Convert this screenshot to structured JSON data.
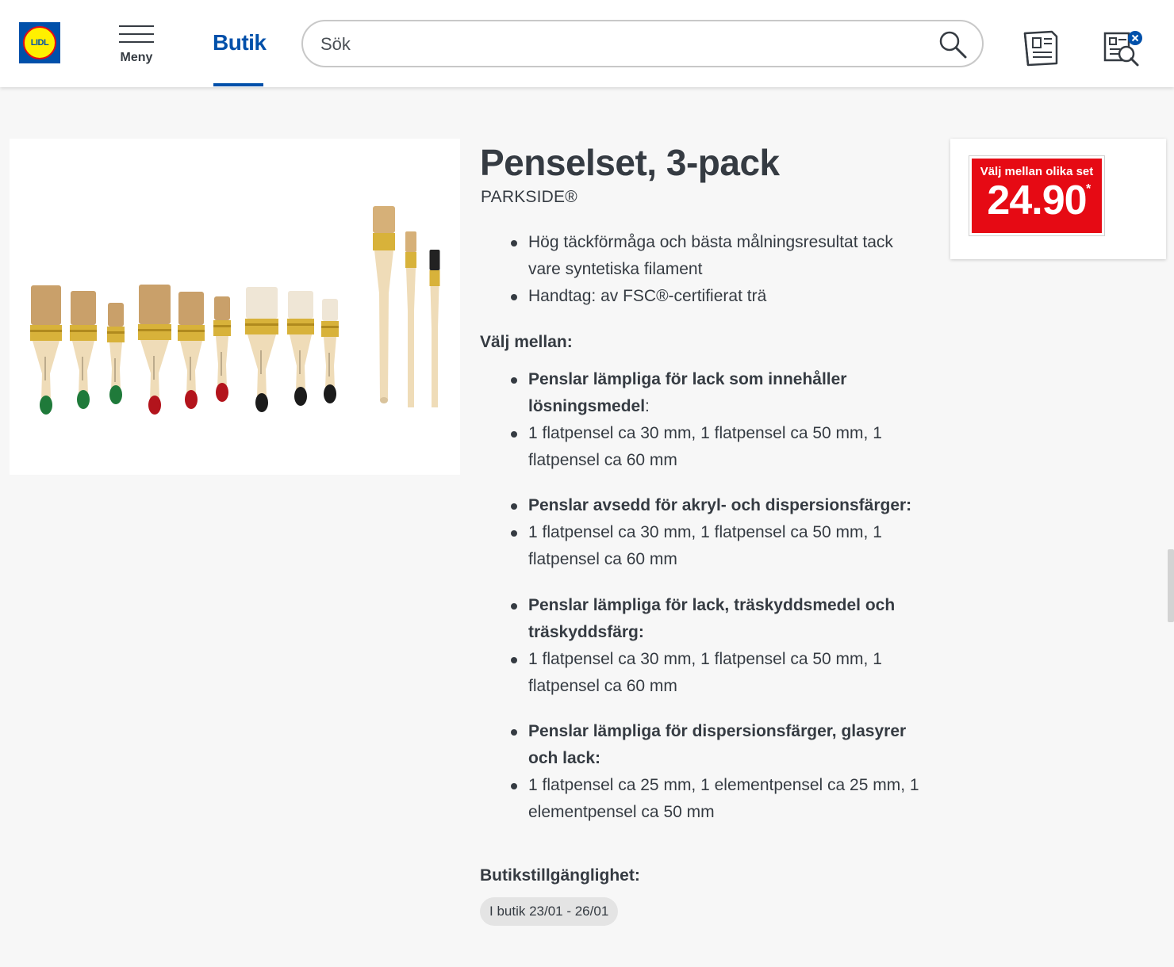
{
  "header": {
    "logo_text": "LIDL",
    "menu_label": "Meny",
    "nav_butik": "Butik",
    "search_placeholder": "Sök",
    "icons": [
      "search-icon",
      "flyer-icon",
      "shopping-list-icon"
    ]
  },
  "product": {
    "title": "Penselset, 3-pack",
    "brand": "PARKSIDE®",
    "features": [
      "Hög täckförmåga och bästa målningsresultat tack vare syntetiska filament",
      "Handtag: av FSC®-certifierat trä"
    ],
    "choose_heading": "Välj mellan:",
    "variants": [
      {
        "name": "Penslar lämpliga för lack som innehåller lösningsmedel",
        "suffix": ":",
        "content": "1 flatpensel ca 30 mm, 1 flatpensel ca 50 mm, 1 flatpensel ca 60 mm"
      },
      {
        "name": "Penslar avsedd för akryl- och dispersionsfärger:",
        "suffix": "",
        "content": "1 flatpensel ca 30 mm, 1 flatpensel ca 50 mm, 1 flatpensel ca 60 mm"
      },
      {
        "name": "Penslar lämpliga för lack, träskyddsmedel och träskyddsfärg:",
        "suffix": "",
        "content": "1 flatpensel ca 30 mm, 1 flatpensel ca 50 mm, 1 flatpensel ca 60 mm"
      },
      {
        "name": "Penslar lämpliga för dispersionsfärger, glasyrer och lack:",
        "suffix": "",
        "content": "1 flatpensel ca 25 mm, 1 elementpensel ca 25 mm, 1 elementpensel ca 50 mm"
      }
    ],
    "availability_heading": "Butikstillgänglighet:",
    "availability_badge": "I butik 23/01 - 26/01"
  },
  "price": {
    "label": "Välj mellan olika set",
    "value": "24.90",
    "star": "*"
  },
  "colors": {
    "brand_blue": "#0050aa",
    "price_red": "#e60a14",
    "logo_yellow": "#fff000",
    "brush_green": "#1f7a3a",
    "brush_red": "#b3141c",
    "brush_black": "#1b1b1b"
  }
}
